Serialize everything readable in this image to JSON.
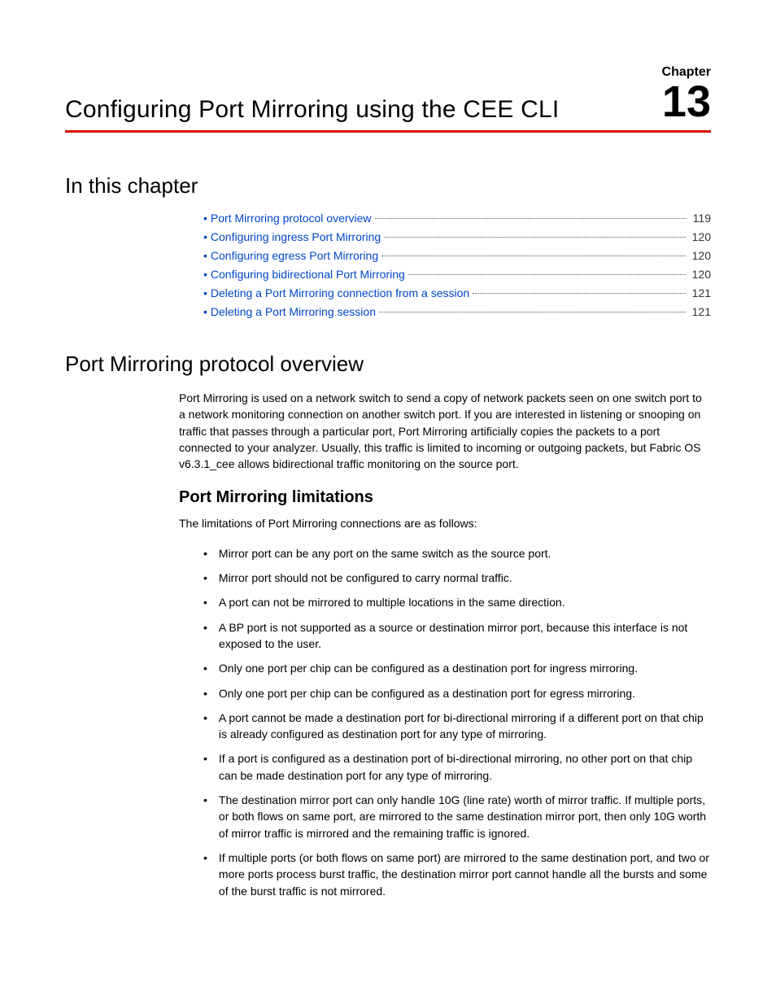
{
  "header": {
    "chapter_label": "Chapter",
    "chapter_number": "13",
    "title": "Configuring Port Mirroring using the CEE CLI"
  },
  "sections": {
    "in_this_chapter": "In this chapter",
    "protocol_overview": "Port Mirroring protocol overview",
    "limitations": "Port Mirroring limitations"
  },
  "toc": [
    {
      "label": "Port Mirroring protocol overview",
      "page": "119"
    },
    {
      "label": "Configuring ingress Port Mirroring",
      "page": "120"
    },
    {
      "label": "Configuring egress Port Mirroring",
      "page": "120"
    },
    {
      "label": "Configuring bidirectional Port Mirroring",
      "page": "120"
    },
    {
      "label": "Deleting a Port Mirroring connection from a session",
      "page": "121"
    },
    {
      "label": "Deleting a Port Mirroring session",
      "page": "121"
    }
  ],
  "overview_paragraph": "Port Mirroring is used on a network switch to send a copy of network packets seen on one switch port to a network monitoring connection on another switch port. If you are interested in listening or snooping on traffic that passes through a particular port, Port Mirroring artificially copies the packets to a port connected to your analyzer. Usually, this traffic is limited to incoming or outgoing packets, but Fabric OS v6.3.1_cee allows bidirectional traffic monitoring on the source port.",
  "limitations_intro": "The limitations of Port Mirroring connections are as follows:",
  "limitations_list": [
    "Mirror port can be any port on the same switch as the source port.",
    "Mirror port should not be configured to carry normal traffic.",
    "A port can not be mirrored to multiple locations in the same direction.",
    "A BP port is not supported as a source or destination mirror port, because this interface is not exposed to the user.",
    "Only one port per chip can be configured as a destination port for ingress mirroring.",
    "Only one port per chip can be configured as a destination port for egress mirroring.",
    "A port cannot be made a destination port for bi-directional mirroring if a different port on that chip is already configured as destination port for any type of mirroring.",
    "If a port is configured as a destination port of bi-directional mirroring, no other port on that chip can be made destination port for any type of mirroring.",
    "The destination mirror port can only handle 10G (line rate) worth of mirror traffic. If multiple ports, or both flows on same port, are mirrored to the same destination mirror port, then only 10G worth of mirror traffic is mirrored and the remaining traffic is ignored.",
    "If multiple ports (or both flows on same port) are mirrored to the same destination port, and two or more ports process burst traffic, the destination mirror port cannot handle all the bursts and some of the burst traffic is not mirrored."
  ]
}
